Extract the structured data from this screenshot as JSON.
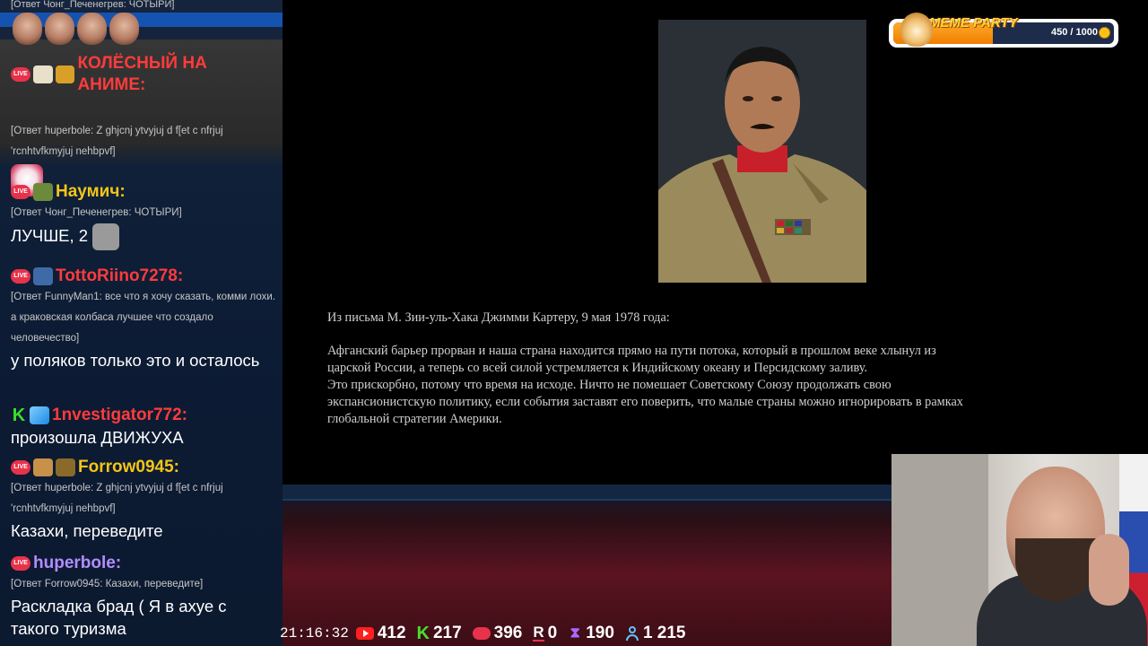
{
  "chat": {
    "top_reply": "[Ответ Чонг_Печенегрев: ЧОТЫРИ]",
    "messages": [
      {
        "user": "КОЛЁСНЫЙ НА АНИМЕ:",
        "color": "#ff3b3b",
        "reply": "[Ответ huperbole: Z ghjcnj ytvyjuj d f[et c nfrjuj 'rcnhtvfkmyjuj nehbpvf]",
        "text": ""
      },
      {
        "user": "Наумич:",
        "color": "#f5c518",
        "reply": "[Ответ Чонг_Печенегрев: ЧОТЫРИ]",
        "text": "ЛУЧШЕ, 2"
      },
      {
        "user": "TottoRiino7278:",
        "color": "#ff3b3b",
        "reply": "[Ответ FunnyMan1: все что я хочу сказать, комми лохи. а краковская колбаса лучшее что создало человечество]",
        "text": "у поляков только это и осталось"
      },
      {
        "user": "1nvestigator772:",
        "color": "#ff3b3b",
        "reply": "",
        "text": "произошла ДВИЖУХА"
      },
      {
        "user": "Forrow0945:",
        "color": "#f5c518",
        "reply": "[Ответ huperbole: Z ghjcnj ytvyjuj d f[et c nfrjuj 'rcnhtvfkmyjuj nehbpvf]",
        "text": "Казахи, переведите"
      },
      {
        "user": "huperbole:",
        "color": "#b48cff",
        "reply": "[Ответ Forrow0945: Казахи, переведите]",
        "text": "Раскладка брад ( Я в ахуе с такого туризма"
      }
    ],
    "live_badge": "LIVE"
  },
  "slide": {
    "source": "Из письма М. Зии-уль-Хака  Джимми Картеру, 9 мая 1978 года:",
    "paragraph1": "Афганский барьер прорван и наша страна находится прямо на пути потока, который в прошлом веке хлынул из царской России, а теперь со всей силой устремляется к Индийскому океану и Персидскому заливу.",
    "paragraph2": "Это прискорбно, потому что время на исходе. Ничто не помешает Советскому Союзу продолжать свою экспансионистскую политику, если события заставят его поверить, что малые страны можно игнорировать в рамках глобальной стратегии Америки."
  },
  "widget": {
    "title": "MEME PARTY",
    "value": "450 / 1000",
    "progress": 0.45
  },
  "stats": {
    "clock": "21:16:32",
    "youtube": "412",
    "kick": "217",
    "vk": "396",
    "rutube": "0",
    "trovo": "190",
    "total": "1 215"
  }
}
